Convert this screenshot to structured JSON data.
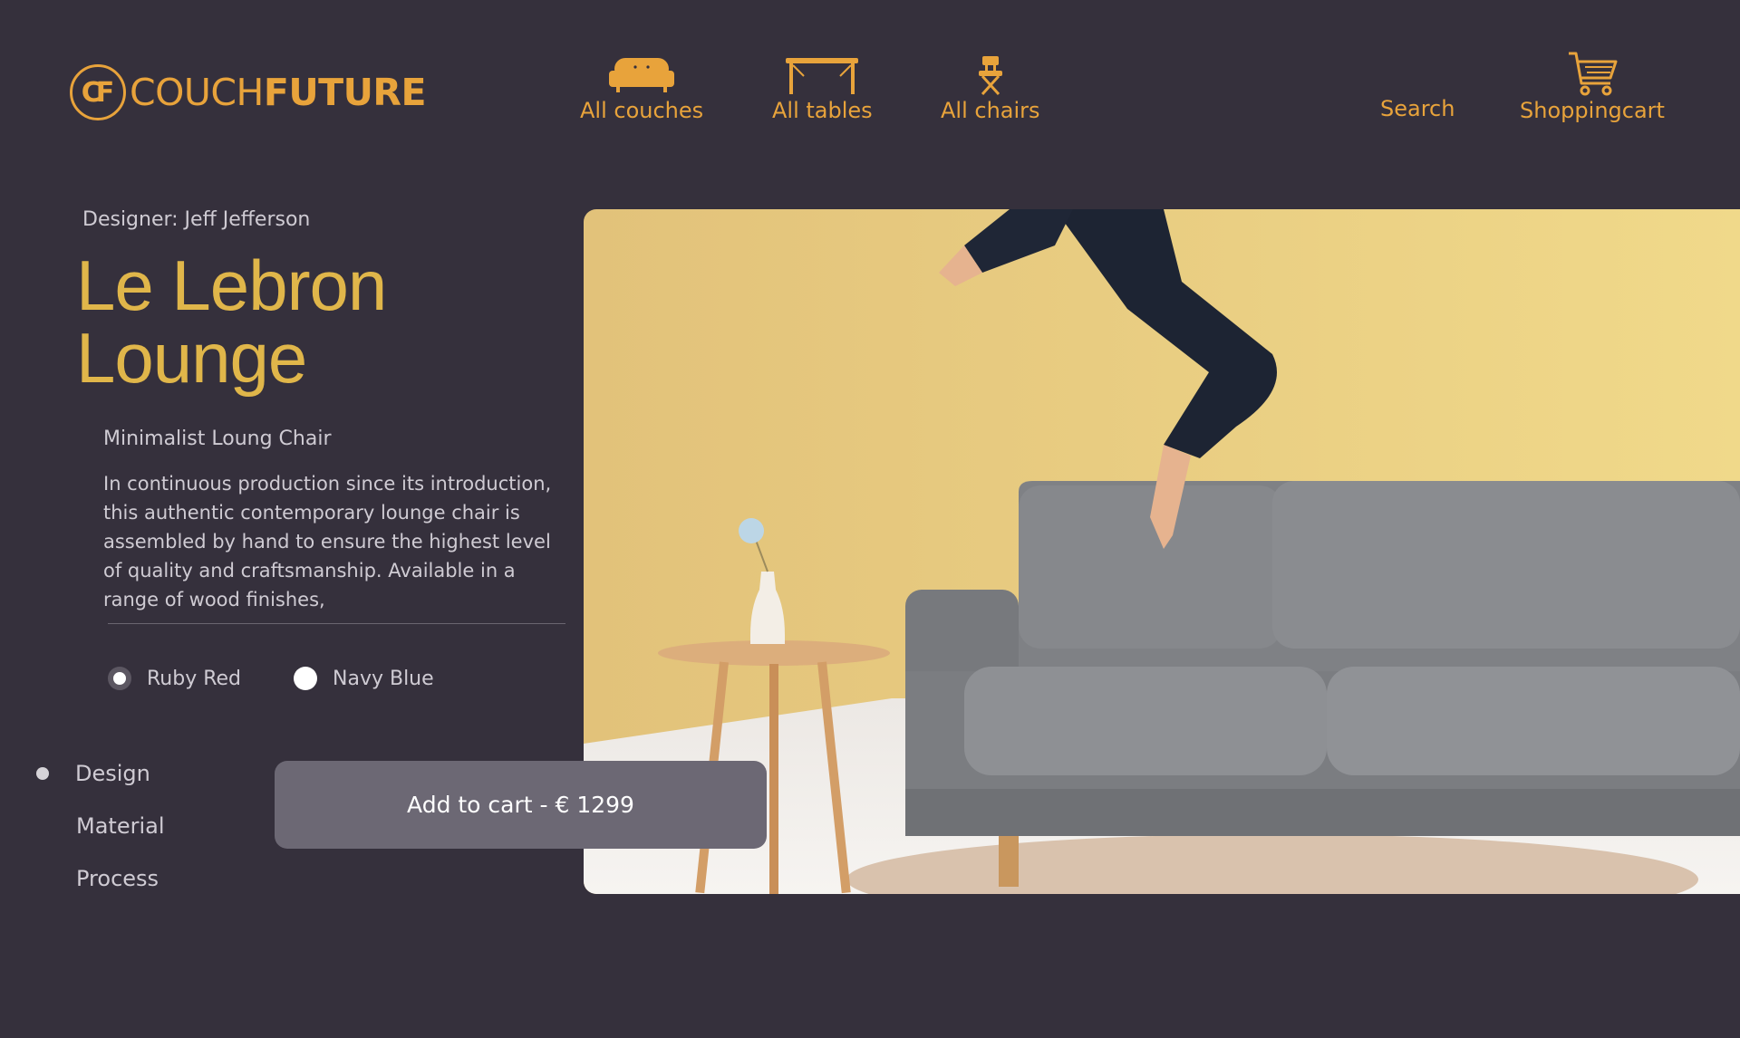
{
  "brand": {
    "mark": "CF",
    "name_light": "COUCH",
    "name_bold": "FUTURE"
  },
  "nav": {
    "couches": "All couches",
    "tables": "All tables",
    "chairs": "All chairs",
    "search": "Search",
    "cart": "Shoppingcart"
  },
  "product": {
    "designer": "Designer: Jeff Jefferson",
    "title_line1": "Le Lebron",
    "title_line2": "Lounge",
    "subtitle": "Minimalist Loung Chair",
    "description": "In continuous production since its introduction, this authentic contemporary lounge chair is assembled by hand to ensure the highest level of quality and craftsmanship. Available in a range of wood finishes,",
    "colors": [
      {
        "label": "Ruby Red",
        "selected": true
      },
      {
        "label": "Navy Blue",
        "selected": false
      }
    ],
    "add_to_cart": "Add to cart -  € 1299"
  },
  "sections": [
    "Design",
    "Material",
    "Process"
  ],
  "theme": {
    "background": "#35303c",
    "accent": "#e8a33b",
    "title": "#e0b64a",
    "button": "#6c6874"
  }
}
